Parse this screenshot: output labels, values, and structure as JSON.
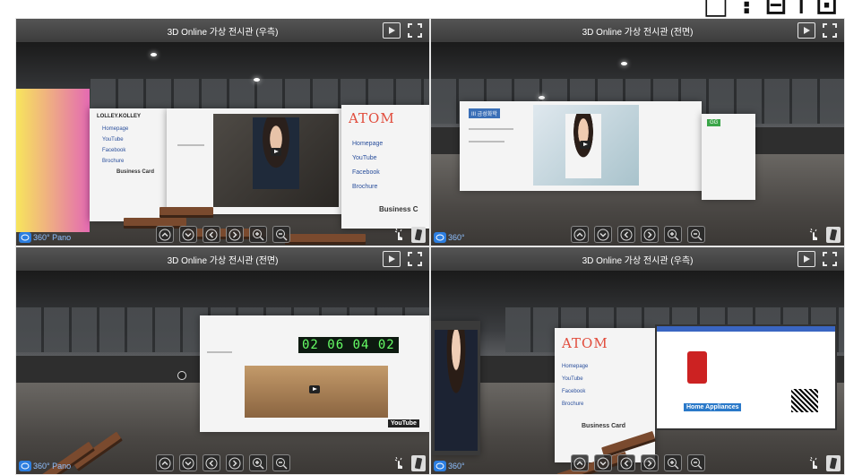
{
  "header": {
    "glyphs": "□ ⁝ ⊟⊤⊡"
  },
  "panels": [
    {
      "title": "3D Online 가상 전시관 (우측)",
      "badge_label": "360° Pano",
      "scene": "right",
      "wall_texts": {
        "brand": "ATOM",
        "links": [
          "Homepage",
          "YouTube",
          "Facebook",
          "Brochure"
        ],
        "card": "Business C",
        "left_brand": "LOLLEY.KOLLEY",
        "left_links": [
          "Homepage",
          "YouTube",
          "Facebook",
          "Brochure"
        ],
        "left_card": "Business Card"
      }
    },
    {
      "title": "3D Online 가상 전시관 (전면)",
      "badge_label": "360°",
      "scene": "front",
      "wall_texts": {
        "left_tag": "III 금성화학",
        "right_tag": "GG"
      }
    },
    {
      "title": "3D Online 가상 전시관 (전면)",
      "badge_label": "360° Pano",
      "scene": "front2",
      "wall_texts": {
        "digital": "02 06 04 02",
        "youtube": "YouTube"
      }
    },
    {
      "title": "3D Online 가상 전시관 (우측)",
      "badge_label": "360°",
      "scene": "right2",
      "wall_texts": {
        "brand": "ATOM",
        "links": [
          "Homepage",
          "YouTube",
          "Facebook",
          "Brochure"
        ],
        "card": "Business Card",
        "product": "Home Appliances"
      }
    }
  ],
  "controls": [
    "up-icon",
    "down-icon",
    "left-icon",
    "right-icon",
    "zoom-in-icon",
    "zoom-out-icon"
  ],
  "colors": {
    "titlebar": "#4a4a4a",
    "badge": "#2c7ee0",
    "brand_red": "#e14b3b",
    "digital_green": "#66ff66"
  }
}
